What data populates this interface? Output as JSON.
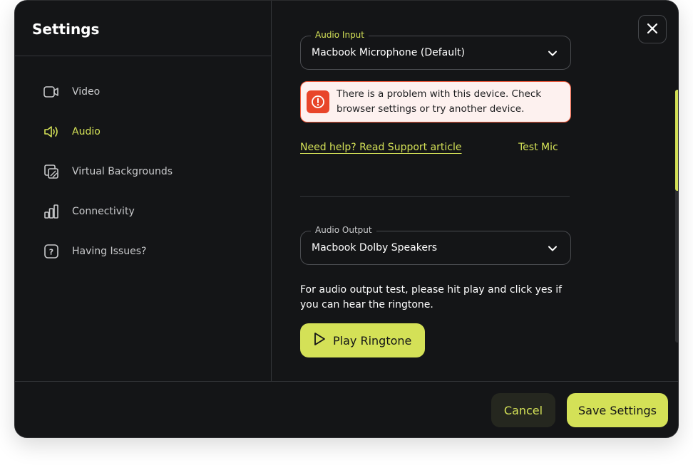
{
  "title": "Settings",
  "sidebar": {
    "items": [
      {
        "label": "Video",
        "icon": "video-camera-icon"
      },
      {
        "label": "Audio",
        "icon": "speaker-icon"
      },
      {
        "label": "Virtual Backgrounds",
        "icon": "virtual-background-icon"
      },
      {
        "label": "Connectivity",
        "icon": "bar-chart-icon"
      },
      {
        "label": "Having Issues?",
        "icon": "question-icon"
      }
    ],
    "active": "Audio"
  },
  "audio_input": {
    "legend": "Audio Input",
    "value": "Macbook Microphone (Default)"
  },
  "alert": {
    "message": "There is a problem with this device. Check browser settings or try another device."
  },
  "help_link": "Need help? Read Support article",
  "test_mic": "Test Mic",
  "audio_output": {
    "legend": "Audio Output",
    "value": "Macbook Dolby Speakers",
    "description": "For audio output test, please hit play and click yes if you can hear the ringtone."
  },
  "play_button": "Play Ringtone",
  "footer": {
    "cancel": "Cancel",
    "save": "Save Settings"
  },
  "colors": {
    "accent": "#d4e157",
    "background": "#141517",
    "alert": "#e8452a"
  }
}
